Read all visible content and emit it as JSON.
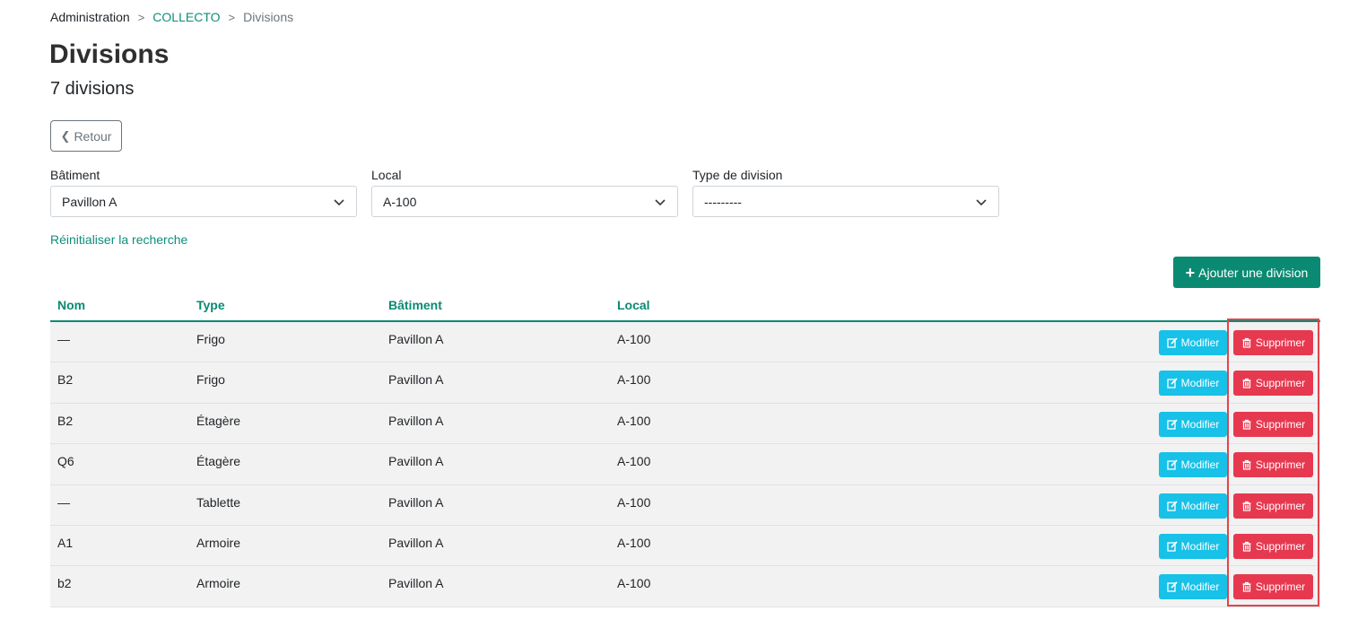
{
  "breadcrumb": {
    "root": "Administration",
    "parent": "COLLECTO",
    "current": "Divisions",
    "separator": ">"
  },
  "page": {
    "title": "Divisions",
    "subtitle": "7 divisions"
  },
  "back_button": {
    "label": "Retour"
  },
  "filters": {
    "building": {
      "label": "Bâtiment",
      "value": "Pavillon A"
    },
    "room": {
      "label": "Local",
      "value": "A-100"
    },
    "division_type": {
      "label": "Type de division",
      "value": "---------"
    }
  },
  "reset_link": "Réinitialiser la recherche",
  "add_button": {
    "label": "Ajouter une division"
  },
  "table": {
    "headers": {
      "name": "Nom",
      "type": "Type",
      "building": "Bâtiment",
      "room": "Local"
    },
    "rows": [
      {
        "name": "—",
        "type": "Frigo",
        "building": "Pavillon A",
        "room": "A-100"
      },
      {
        "name": "B2",
        "type": "Frigo",
        "building": "Pavillon A",
        "room": "A-100"
      },
      {
        "name": "B2",
        "type": "Étagère",
        "building": "Pavillon A",
        "room": "A-100"
      },
      {
        "name": "Q6",
        "type": "Étagère",
        "building": "Pavillon A",
        "room": "A-100"
      },
      {
        "name": "—",
        "type": "Tablette",
        "building": "Pavillon A",
        "room": "A-100"
      },
      {
        "name": "A1",
        "type": "Armoire",
        "building": "Pavillon A",
        "room": "A-100"
      },
      {
        "name": "b2",
        "type": "Armoire",
        "building": "Pavillon A",
        "room": "A-100"
      }
    ],
    "edit_label": "Modifier",
    "delete_label": "Supprimer"
  },
  "colors": {
    "accent": "#0a8a72",
    "edit": "#17c1e8",
    "delete": "#e63950",
    "highlight": "#e0454e"
  }
}
